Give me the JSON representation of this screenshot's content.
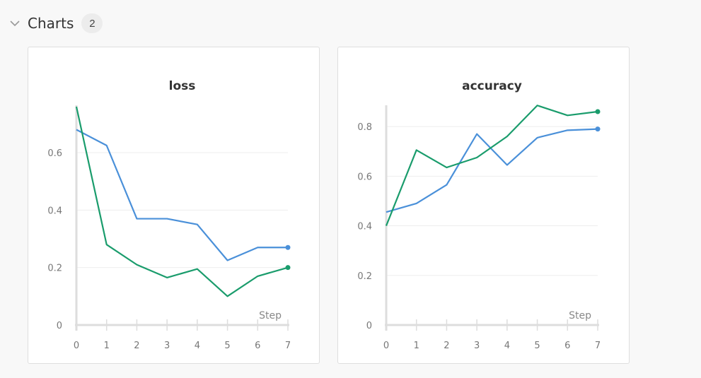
{
  "section": {
    "title": "Charts",
    "count": "2",
    "icon": "chevron-down-icon"
  },
  "chart_data": [
    {
      "type": "line",
      "title": "loss",
      "xlabel": "Step",
      "ylabel": "",
      "x": [
        0,
        1,
        2,
        3,
        4,
        5,
        6,
        7
      ],
      "xlim": [
        0,
        7
      ],
      "ylim": [
        0,
        0.76
      ],
      "yticks": [
        0,
        0.2,
        0.4,
        0.6
      ],
      "ytick_labels": [
        "0",
        "0.2",
        "0.4",
        "0.6"
      ],
      "xtick_labels": [
        "0",
        "1",
        "2",
        "3",
        "4",
        "5",
        "6",
        "7"
      ],
      "grid": true,
      "series": [
        {
          "color": "#4a90d9",
          "values": [
            0.68,
            0.625,
            0.37,
            0.37,
            0.35,
            0.225,
            0.27,
            0.27
          ]
        },
        {
          "color": "#1a9c6c",
          "values": [
            0.76,
            0.28,
            0.21,
            0.165,
            0.195,
            0.1,
            0.17,
            0.2
          ]
        }
      ]
    },
    {
      "type": "line",
      "title": "accuracy",
      "xlabel": "Step",
      "ylabel": "",
      "x": [
        0,
        1,
        2,
        3,
        4,
        5,
        6,
        7
      ],
      "xlim": [
        0,
        7
      ],
      "ylim": [
        0,
        0.88
      ],
      "yticks": [
        0,
        0.2,
        0.4,
        0.6,
        0.8
      ],
      "ytick_labels": [
        "0",
        "0.2",
        "0.4",
        "0.6",
        "0.8"
      ],
      "xtick_labels": [
        "0",
        "1",
        "2",
        "3",
        "4",
        "5",
        "6",
        "7"
      ],
      "grid": true,
      "series": [
        {
          "color": "#4a90d9",
          "values": [
            0.455,
            0.49,
            0.565,
            0.77,
            0.645,
            0.755,
            0.785,
            0.79
          ]
        },
        {
          "color": "#1a9c6c",
          "values": [
            0.4,
            0.705,
            0.635,
            0.675,
            0.76,
            0.885,
            0.845,
            0.86
          ]
        }
      ]
    }
  ]
}
